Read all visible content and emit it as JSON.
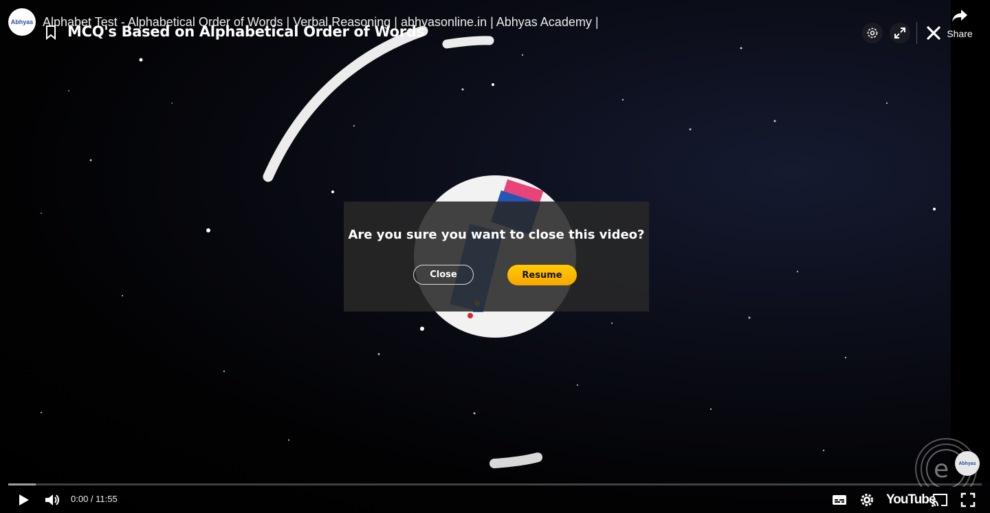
{
  "header": {
    "video_title": "Alphabet Test - Alphabetical Order of Words | Verbal Reasoning | abhyasonline.in | Abhyas Academy |",
    "overlay_heading": "MCQ's Based on Alphabetical Order of Words",
    "channel_logo_text": "Abhyas",
    "share_label": "Share"
  },
  "dialog": {
    "message": "Are you sure you want to close this video?",
    "close_label": "Close",
    "resume_label": "Resume"
  },
  "player": {
    "current_time": "0:00",
    "duration": "11:55",
    "time_display": "0:00 / 11:55",
    "played_fraction": 0,
    "buffered_fraction": 0.028,
    "brand_label": "YouTube",
    "watermark_logo_text": "Abhyas"
  },
  "colors": {
    "accent": "#fbb600",
    "background": "#000000",
    "dialog_bg": "#282828"
  },
  "icons": {
    "bookmark": "bookmark-icon",
    "settings_top": "gear-icon",
    "expand": "expand-icon",
    "close": "close-icon",
    "share": "share-arrow-icon",
    "play": "play-icon",
    "volume": "volume-icon",
    "captions": "captions-icon",
    "settings": "gear-icon",
    "cast": "cast-icon",
    "fullscreen": "fullscreen-icon"
  }
}
